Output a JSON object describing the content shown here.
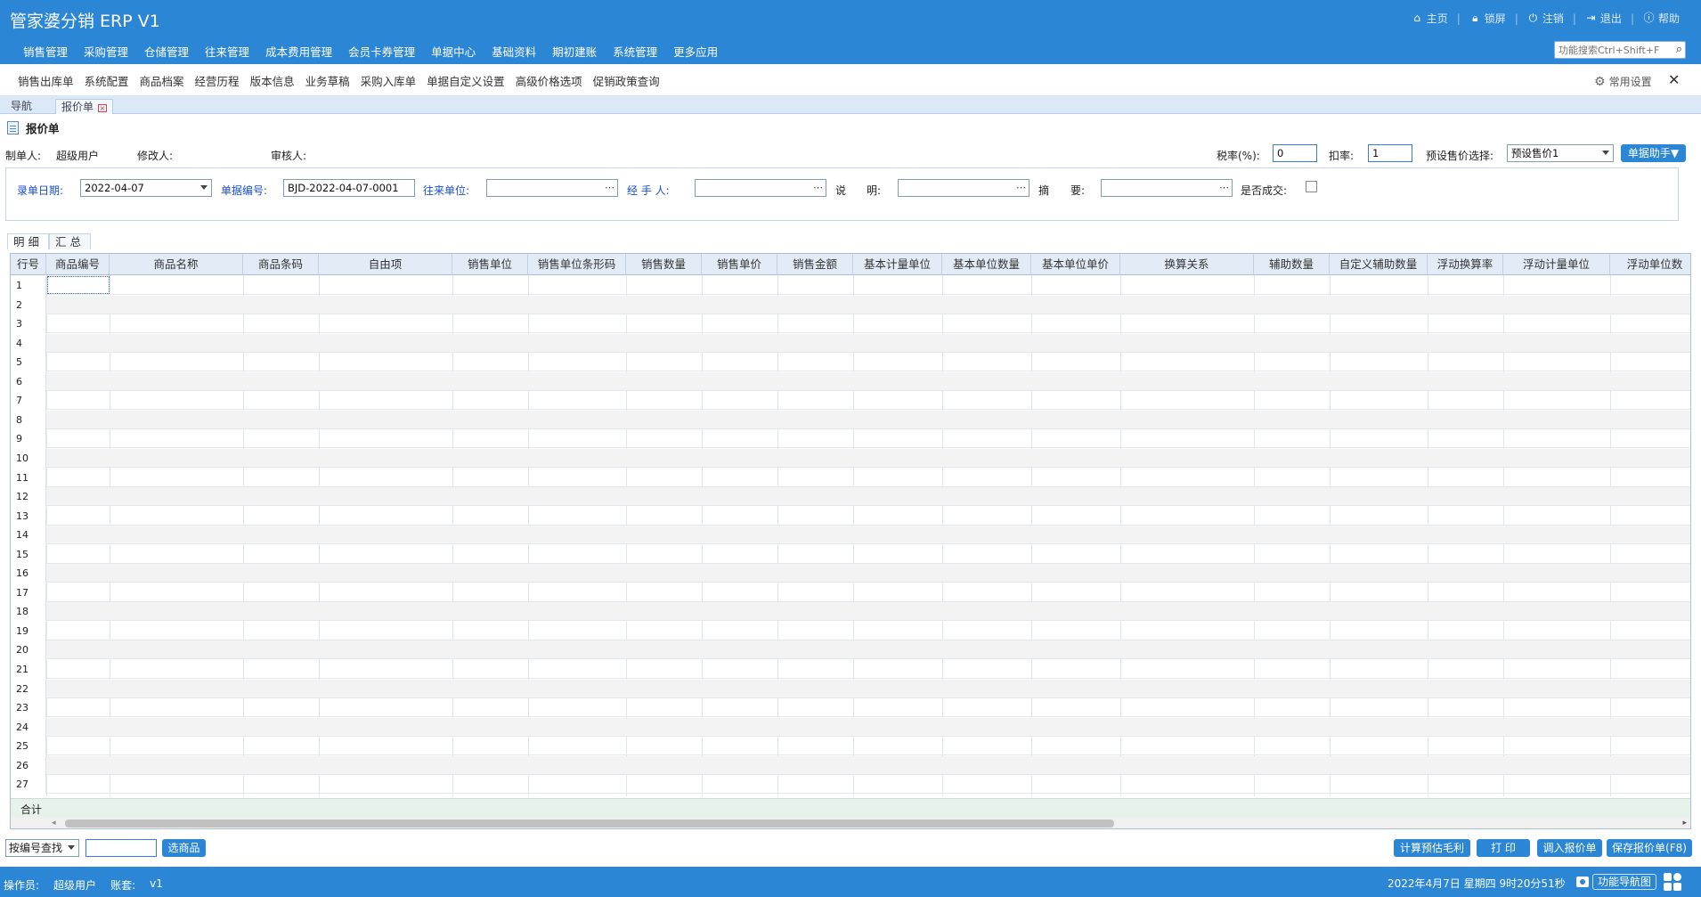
{
  "app": {
    "title": "管家婆分销 ERP V1"
  },
  "top_links": [
    {
      "label": "主页",
      "icon": "home-icon"
    },
    {
      "label": "锁屏",
      "icon": "lock-icon"
    },
    {
      "label": "注销",
      "icon": "logout-icon"
    },
    {
      "label": "退出",
      "icon": "exit-icon"
    },
    {
      "label": "帮助",
      "icon": "help-icon"
    }
  ],
  "main_menu": [
    "销售管理",
    "采购管理",
    "仓储管理",
    "往来管理",
    "成本费用管理",
    "会员卡券管理",
    "单据中心",
    "基础资料",
    "期初建账",
    "系统管理",
    "更多应用"
  ],
  "func_search": {
    "placeholder": "功能搜索Ctrl+Shift+F"
  },
  "quick_links": [
    "销售出库单",
    "系统配置",
    "商品档案",
    "经营历程",
    "版本信息",
    "业务草稿",
    "采购入库单",
    "单据自定义设置",
    "高级价格选项",
    "促销政策查询"
  ],
  "common_settings": "常用设置",
  "page_tabs": {
    "nav": "导航",
    "quote": "报价单"
  },
  "doc": {
    "title": "报价单",
    "maker_label": "制单人:",
    "maker_value": "超级用户",
    "modifier_label": "修改人:",
    "auditor_label": "审核人:",
    "tax_label": "税率(%):",
    "tax_value": "0",
    "discount_label": "扣率:",
    "discount_value": "1",
    "preset_price_label": "预设售价选择:",
    "preset_price_value": "预设售价1",
    "helper_button": "单据助手▼"
  },
  "filters": {
    "date_label": "录单日期:",
    "date_value": "2022-04-07",
    "number_label": "单据编号:",
    "number_value": "BJD-2022-04-07-0001",
    "partner_label": "往来单位:",
    "handler_label": "经 手 人:",
    "desc_label_1": "说",
    "desc_label_2": "明:",
    "summary_label_1": "摘",
    "summary_label_2": "要:",
    "deal_label": "是否成交:"
  },
  "sub_tabs": [
    "明细",
    "汇总"
  ],
  "grid": {
    "row_header": "行号",
    "columns": [
      "商品编号",
      "商品名称",
      "商品条码",
      "自由项",
      "销售单位",
      "销售单位条形码",
      "销售数量",
      "销售单价",
      "销售金额",
      "基本计量单位",
      "基本单位数量",
      "基本单位单价",
      "换算关系",
      "辅助数量",
      "自定义辅助数量",
      "浮动换算率",
      "浮动计量单位",
      "浮动单位数"
    ],
    "rows": [
      "1",
      "2",
      "3",
      "4",
      "5",
      "6",
      "7",
      "8",
      "9",
      "10",
      "11",
      "12",
      "13",
      "14",
      "15",
      "16",
      "17",
      "18",
      "19",
      "20",
      "21",
      "22",
      "23",
      "24",
      "25",
      "26",
      "27"
    ],
    "total_label": "合计"
  },
  "bottom": {
    "search_mode": "按编号查找",
    "select_product_button": "选商品",
    "calc_button": "计算预估毛利",
    "print_button": "打 印",
    "import_button": "调入报价单",
    "save_button": "保存报价单(F8)"
  },
  "status": {
    "operator_label": "操作员:",
    "operator_value": "超级用户",
    "account_label": "账套:",
    "account_value": "v1",
    "datetime": "2022年4月7日 星期四 9时20分51秒",
    "nav_button": "功能导航图"
  },
  "colors": {
    "brand": "#2b86d6",
    "link_blue": "#1a4fd6",
    "grid_header": "#e3ecf6",
    "total_row": "#e6f2ea"
  }
}
